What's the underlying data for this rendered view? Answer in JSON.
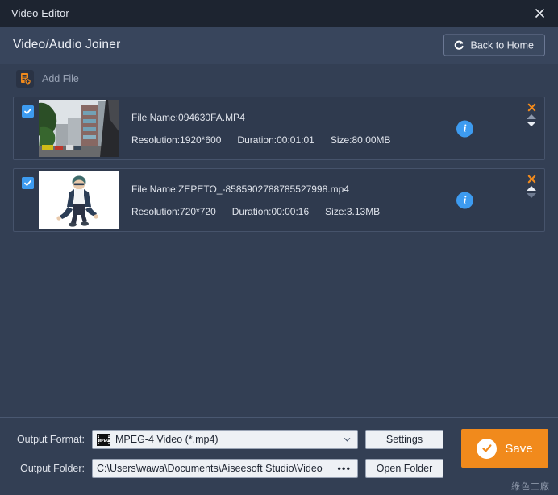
{
  "window": {
    "title": "Video Editor",
    "close_icon": "close-icon"
  },
  "header": {
    "title": "Video/Audio Joiner",
    "back_button": {
      "label": "Back to Home",
      "icon": "redo-arrow-icon"
    }
  },
  "toolbar": {
    "add_file": {
      "label": "Add File",
      "icon": "add-file-icon"
    }
  },
  "files": [
    {
      "checked": true,
      "file_name": "File Name:094630FA.MP4",
      "resolution": "Resolution:1920*600",
      "duration": "Duration:00:01:01",
      "size": "Size:80.00MB",
      "info_label": "i",
      "remove_icon": "close-icon",
      "move_up_icon": "triangle-up-icon",
      "move_down_icon": "triangle-down-icon",
      "thumbnail": "city-street-photo"
    },
    {
      "checked": true,
      "file_name": "File Name:ZEPETO_-8585902788785527998.mp4",
      "resolution": "Resolution:720*720",
      "duration": "Duration:00:00:16",
      "size": "Size:3.13MB",
      "info_label": "i",
      "remove_icon": "close-icon",
      "move_up_icon": "triangle-up-icon",
      "move_down_icon": "triangle-down-icon",
      "thumbnail": "zepeto-avatar-photo"
    }
  ],
  "bottom": {
    "output_format_label": "Output Format:",
    "output_format_value": "MPEG-4 Video (*.mp4)",
    "output_format_icon": "mpeg-film-icon",
    "settings_label": "Settings",
    "output_folder_label": "Output Folder:",
    "output_folder_value": "C:\\Users\\wawa\\Documents\\Aiseesoft Studio\\Video",
    "browse_label": "•••",
    "open_folder_label": "Open Folder",
    "save_label": "Save",
    "save_icon": "check-circle-icon"
  },
  "watermark": "綠色工廠",
  "colors": {
    "accent_orange": "#f18a1c",
    "accent_blue": "#3d9bf0",
    "window_bg": "#333f54",
    "titlebar_bg": "#1d2430",
    "header_bg": "#38455c",
    "row_bg": "#2f3a4e"
  }
}
